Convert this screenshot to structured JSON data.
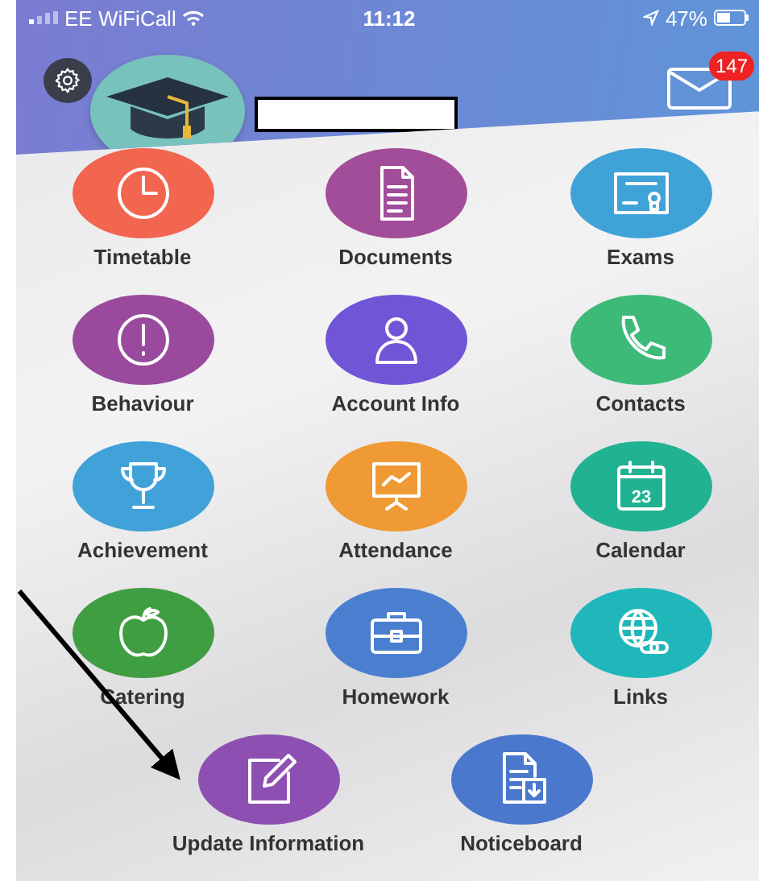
{
  "status_bar": {
    "carrier": "EE WiFiCall",
    "time": "11:12",
    "battery": "47%"
  },
  "header": {
    "message_count": "147"
  },
  "tiles": [
    {
      "label": "Timetable",
      "kind": "clock",
      "color": "#f2654f"
    },
    {
      "label": "Documents",
      "kind": "document",
      "color": "#a24d99"
    },
    {
      "label": "Exams",
      "kind": "certificate",
      "color": "#3fa3d8"
    },
    {
      "label": "Behaviour",
      "kind": "alert",
      "color": "#9a4a9c"
    },
    {
      "label": "Account Info",
      "kind": "person",
      "color": "#7055d6"
    },
    {
      "label": "Contacts",
      "kind": "phone",
      "color": "#3dba78"
    },
    {
      "label": "Achievement",
      "kind": "trophy",
      "color": "#41a2d9"
    },
    {
      "label": "Attendance",
      "kind": "presentation",
      "color": "#ef9a35"
    },
    {
      "label": "Calendar",
      "kind": "calendar",
      "color": "#21b292",
      "icon_text": "23"
    },
    {
      "label": "Catering",
      "kind": "apple",
      "color": "#3f9d42"
    },
    {
      "label": "Homework",
      "kind": "briefcase",
      "color": "#4a7fd0"
    },
    {
      "label": "Links",
      "kind": "globe",
      "color": "#1fb7b9"
    },
    {
      "label": "Update Information",
      "kind": "edit",
      "color": "#8e4fb3"
    },
    {
      "label": "Noticeboard",
      "kind": "download-doc",
      "color": "#4a78cc"
    }
  ]
}
